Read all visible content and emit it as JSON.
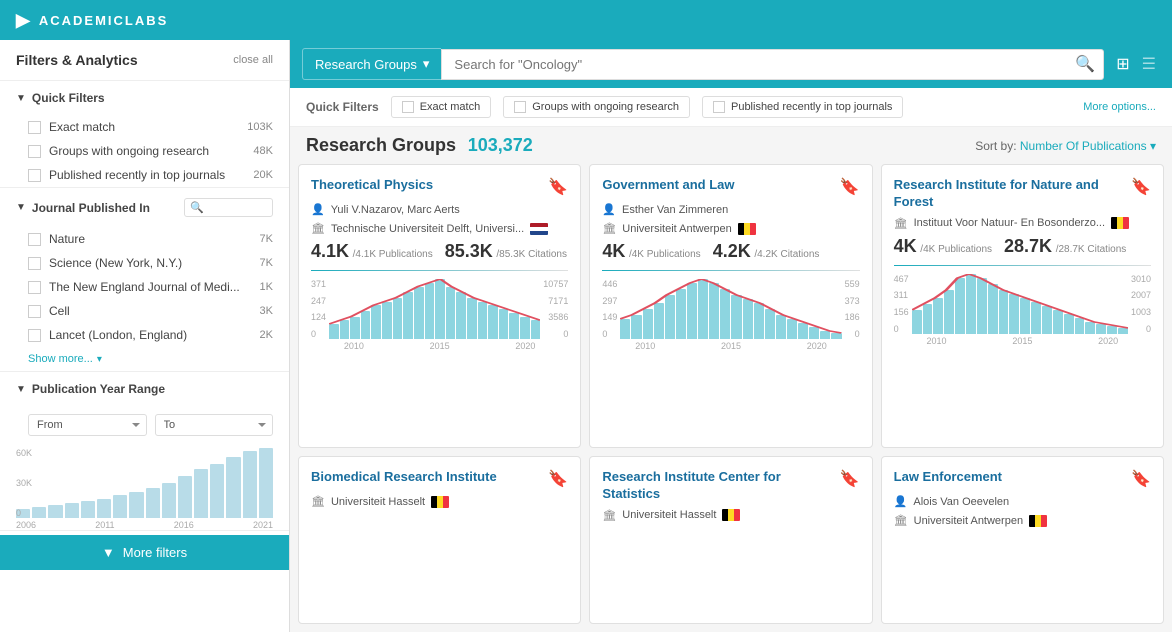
{
  "header": {
    "logo_text": "ACADEMICLABS",
    "logo_icon": "▶"
  },
  "sidebar": {
    "title": "Filters & Analytics",
    "close_all": "close all",
    "quick_filters": {
      "label": "Quick Filters",
      "items": [
        {
          "label": "Exact match",
          "count": "103K",
          "checked": false
        },
        {
          "label": "Groups with ongoing research",
          "count": "48K",
          "checked": false
        },
        {
          "label": "Published recently in top journals",
          "count": "20K",
          "checked": false
        }
      ]
    },
    "journal_published": {
      "label": "Journal Published In",
      "items": [
        {
          "label": "Nature",
          "count": "7K"
        },
        {
          "label": "Science (New York, N.Y.)",
          "count": "7K"
        },
        {
          "label": "The New England Journal of Medi...",
          "count": "1K"
        },
        {
          "label": "Cell",
          "count": "3K"
        },
        {
          "label": "Lancet (London, England)",
          "count": "2K"
        }
      ],
      "show_more": "Show more...",
      "search_placeholder": ""
    },
    "publication_year": {
      "label": "Publication Year Range",
      "from_label": "From",
      "to_label": "To",
      "chart_labels": [
        "2006",
        "2011",
        "2016",
        "2021"
      ],
      "y_labels": [
        "60K",
        "30K",
        "0"
      ],
      "bars": [
        10,
        12,
        14,
        16,
        18,
        20,
        25,
        28,
        32,
        38,
        45,
        52,
        58,
        65,
        72,
        75
      ]
    },
    "more_filters": "▼  More filters"
  },
  "search": {
    "category": "Research Groups",
    "placeholder": "Search for \"Oncology\"",
    "dropdown_icon": "▾"
  },
  "quick_filters_bar": {
    "label": "Quick Filters",
    "chips": [
      {
        "label": "Exact match"
      },
      {
        "label": "Groups with ongoing research"
      },
      {
        "label": "Published recently in top journals"
      }
    ],
    "more_options": "More options..."
  },
  "results": {
    "title": "Research Groups",
    "count": "103,372",
    "sort_label": "Sort by:",
    "sort_value": "Number Of Publications",
    "sort_arrow": "▾"
  },
  "cards": [
    {
      "title": "Theoretical Physics",
      "bookmark": "🔖",
      "author_icon": "👤",
      "author": "Yuli V.Nazarov, Marc Aerts",
      "institute_icon": "🏛",
      "institute": "Technische Universiteit Delft, Universi...",
      "flag": "nl",
      "pub_big": "4.1K",
      "pub_sub": "/4.1K Publications",
      "cite_big": "85.3K",
      "cite_sub": "/85.3K Citations",
      "y_left": [
        "371",
        "247",
        "124",
        "0"
      ],
      "y_right": [
        "10757",
        "7171",
        "3586",
        "0"
      ],
      "x_labels": [
        "2010",
        "2015",
        "2020"
      ],
      "bars": [
        8,
        10,
        12,
        15,
        18,
        20,
        22,
        25,
        28,
        30,
        32,
        28,
        25,
        22,
        20,
        18,
        16,
        14,
        12,
        10
      ]
    },
    {
      "title": "Government and Law",
      "bookmark": "🔖",
      "author_icon": "👤",
      "author": "Esther Van Zimmeren",
      "institute_icon": "🏛",
      "institute": "Universiteit Antwerpen",
      "flag": "be",
      "pub_big": "4K",
      "pub_sub": "/4K Publications",
      "cite_big": "4.2K",
      "cite_sub": "/4.2K Citations",
      "y_left": [
        "446",
        "297",
        "149",
        "0"
      ],
      "y_right": [
        "559",
        "373",
        "186",
        "0"
      ],
      "x_labels": [
        "2010",
        "2015",
        "2020"
      ],
      "bars": [
        10,
        12,
        15,
        18,
        22,
        25,
        28,
        30,
        28,
        25,
        22,
        20,
        18,
        15,
        12,
        10,
        8,
        6,
        4,
        3
      ]
    },
    {
      "title": "Research Institute for Nature and Forest",
      "bookmark": "🔖",
      "author_icon": "",
      "author": "",
      "institute_icon": "🏛",
      "institute": "Instituut Voor Natuur- En Bosonderzo...",
      "flag": "be",
      "pub_big": "4K",
      "pub_sub": "/4K Publications",
      "cite_big": "28.7K",
      "cite_sub": "/28.7K Citations",
      "y_left": [
        "467",
        "311",
        "156",
        "0"
      ],
      "y_right": [
        "3010",
        "2007",
        "1003",
        "0"
      ],
      "x_labels": [
        "2010",
        "2015",
        "2020"
      ],
      "bars": [
        12,
        15,
        18,
        22,
        28,
        30,
        28,
        25,
        22,
        20,
        18,
        16,
        14,
        12,
        10,
        8,
        6,
        5,
        4,
        3
      ]
    },
    {
      "title": "Biomedical Research Institute",
      "bookmark": "🔖",
      "author_icon": "",
      "author": "",
      "institute_icon": "🏛",
      "institute": "Universiteit Hasselt",
      "flag": "be",
      "pub_big": "",
      "pub_sub": "",
      "cite_big": "",
      "cite_sub": "",
      "y_left": [],
      "y_right": [],
      "x_labels": [],
      "bars": []
    },
    {
      "title": "Research Institute Center for Statistics",
      "bookmark": "🔖",
      "author_icon": "",
      "author": "",
      "institute_icon": "🏛",
      "institute": "Universiteit Hasselt",
      "flag": "be",
      "pub_big": "",
      "pub_sub": "",
      "cite_big": "",
      "cite_sub": "",
      "y_left": [],
      "y_right": [],
      "x_labels": [],
      "bars": []
    },
    {
      "title": "Law Enforcement",
      "bookmark": "🔖",
      "author_icon": "👤",
      "author": "Alois Van Oeevelen",
      "institute_icon": "🏛",
      "institute": "Universiteit Antwerpen",
      "flag": "be",
      "pub_big": "",
      "pub_sub": "",
      "cite_big": "",
      "cite_sub": "",
      "y_left": [],
      "y_right": [],
      "x_labels": [],
      "bars": []
    }
  ]
}
